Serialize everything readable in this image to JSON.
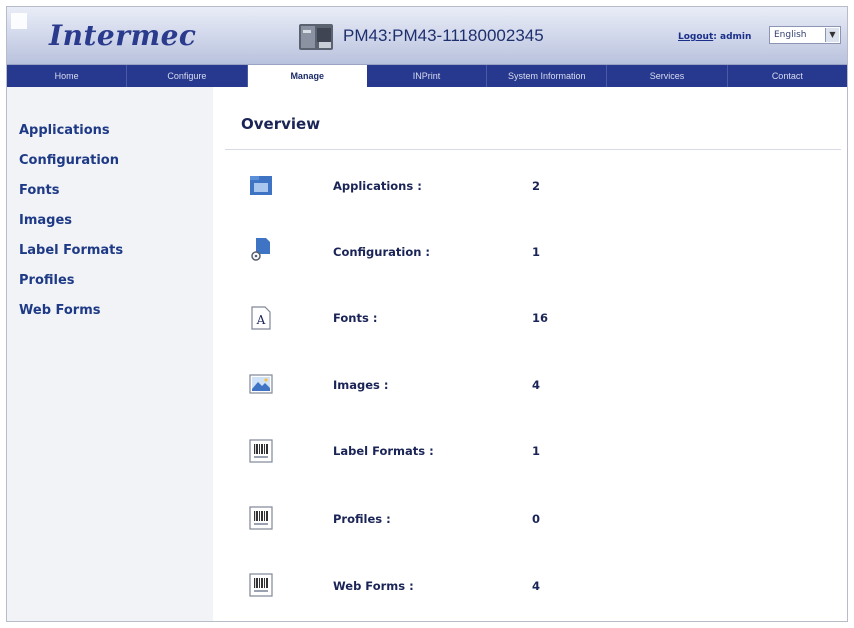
{
  "header": {
    "logo": "Intermec",
    "model": "PM43:PM43-11180002345",
    "logout_label": "Logout",
    "user": ": admin",
    "language": "English"
  },
  "nav": {
    "items": [
      "Home",
      "Configure",
      "Manage",
      "INPrint",
      "System Information",
      "Services",
      "Contact"
    ],
    "active": "Manage"
  },
  "sidebar": {
    "items": [
      "Applications",
      "Configuration",
      "Fonts",
      "Images",
      "Label Formats",
      "Profiles",
      "Web Forms"
    ]
  },
  "main": {
    "title": "Overview",
    "rows": [
      {
        "label": "Applications :",
        "count": "2",
        "icon": "folder-icon"
      },
      {
        "label": "Configuration :",
        "count": "1",
        "icon": "config-file-icon"
      },
      {
        "label": "Fonts :",
        "count": "16",
        "icon": "font-icon"
      },
      {
        "label": "Images :",
        "count": "4",
        "icon": "image-icon"
      },
      {
        "label": "Label Formats :",
        "count": "1",
        "icon": "barcode-icon"
      },
      {
        "label": "Profiles :",
        "count": "0",
        "icon": "barcode-icon"
      },
      {
        "label": "Web Forms :",
        "count": "4",
        "icon": "barcode-icon"
      }
    ]
  },
  "colors": {
    "nav_bg": "#27388f",
    "brand_blue": "#2a3a8c",
    "sidebar_bg": "#f2f3f7"
  }
}
